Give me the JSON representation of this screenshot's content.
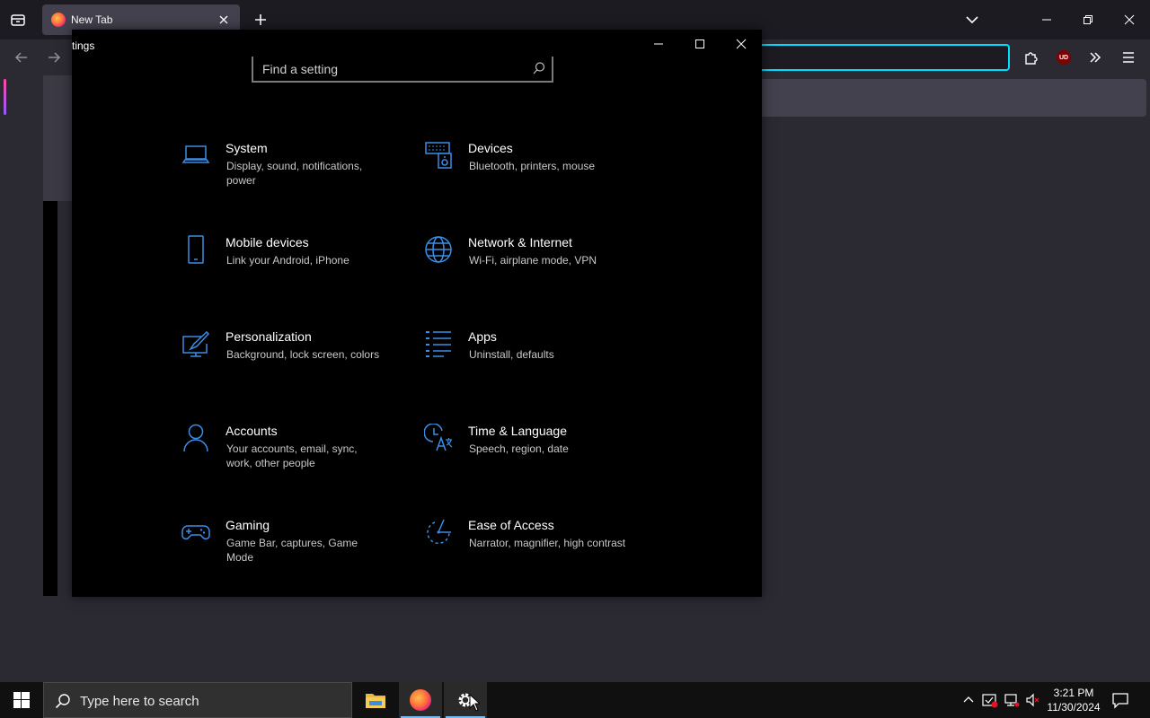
{
  "browser": {
    "tab": {
      "title": "New Tab"
    },
    "colors": {
      "urlbar_focus": "#00ddff",
      "tab_bg": "#42414d"
    }
  },
  "settings": {
    "window_title": "tings",
    "search": {
      "placeholder": "Find a setting"
    },
    "categories": [
      {
        "name": "System",
        "desc": "Display, sound, notifications, power",
        "icon": "laptop-icon"
      },
      {
        "name": "Devices",
        "desc": "Bluetooth, printers, mouse",
        "icon": "keyboard-speaker-icon"
      },
      {
        "name": "Mobile devices",
        "desc": "Link your Android, iPhone",
        "icon": "phone-icon"
      },
      {
        "name": "Network & Internet",
        "desc": "Wi-Fi, airplane mode, VPN",
        "icon": "globe-icon"
      },
      {
        "name": "Personalization",
        "desc": "Background, lock screen, colors",
        "icon": "paint-icon"
      },
      {
        "name": "Apps",
        "desc": "Uninstall, defaults",
        "icon": "apps-list-icon"
      },
      {
        "name": "Accounts",
        "desc": "Your accounts, email, sync, work, other people",
        "icon": "person-icon"
      },
      {
        "name": "Time & Language",
        "desc": "Speech, region, date",
        "icon": "time-language-icon"
      },
      {
        "name": "Gaming",
        "desc": "Game Bar, captures, Game Mode",
        "icon": "gamepad-icon"
      },
      {
        "name": "Ease of Access",
        "desc": "Narrator, magnifier, high contrast",
        "icon": "ease-of-access-icon"
      }
    ],
    "accent": "#3a8ee6"
  },
  "taskbar": {
    "search_placeholder": "Type here to search",
    "time": "3:21 PM",
    "date": "11/30/2024"
  }
}
